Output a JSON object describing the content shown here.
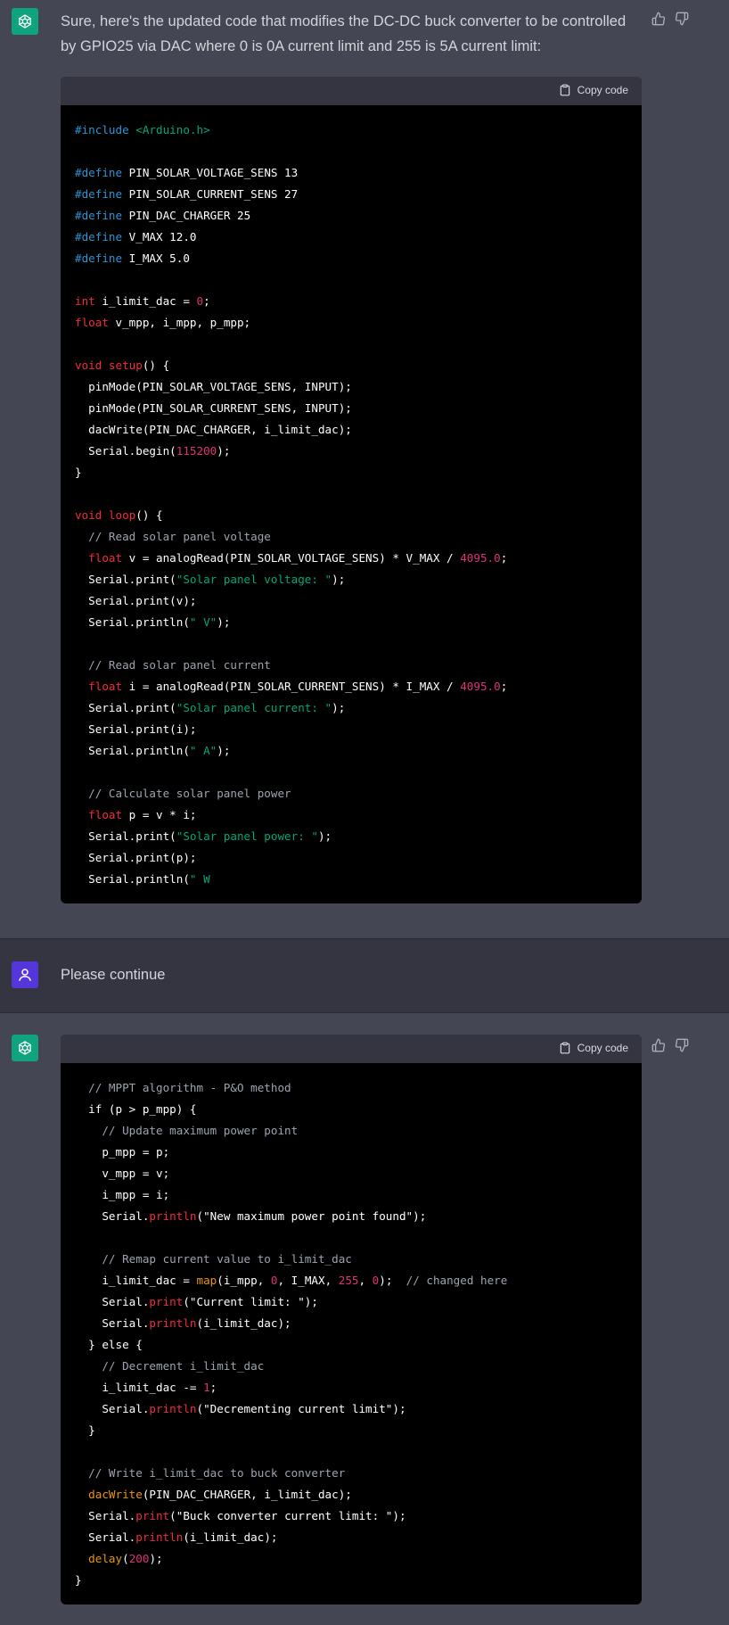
{
  "messages": {
    "first": {
      "text": "Sure, here's the updated code that modifies the DC-DC buck converter to be controlled by GPIO25 via DAC where 0 is 0A current limit and 255 is 5A current limit:",
      "copy_label": "Copy code",
      "code": [
        [
          [
            "#",
            "kw"
          ],
          [
            "include ",
            "kw"
          ],
          [
            "<Arduino.h>",
            "inc"
          ]
        ],
        [],
        [
          [
            "#define ",
            "kw"
          ],
          [
            "PIN_SOLAR_VOLTAGE_SENS 13",
            ""
          ]
        ],
        [
          [
            "#define ",
            "kw"
          ],
          [
            "PIN_SOLAR_CURRENT_SENS 27",
            ""
          ]
        ],
        [
          [
            "#define ",
            "kw"
          ],
          [
            "PIN_DAC_CHARGER 25",
            ""
          ]
        ],
        [
          [
            "#define ",
            "kw"
          ],
          [
            "V_MAX 12.0",
            ""
          ]
        ],
        [
          [
            "#define ",
            "kw"
          ],
          [
            "I_MAX 5.0",
            ""
          ]
        ],
        [],
        [
          [
            "int ",
            "ty"
          ],
          [
            "i_limit_dac = ",
            ""
          ],
          [
            "0",
            "num"
          ],
          [
            ";",
            ""
          ]
        ],
        [
          [
            "float ",
            "ty"
          ],
          [
            "v_mpp, i_mpp, p_mpp;",
            ""
          ]
        ],
        [],
        [
          [
            "void ",
            "ty"
          ],
          [
            "setup",
            "ty"
          ],
          [
            "() {",
            ""
          ]
        ],
        [
          [
            "  pinMode(PIN_SOLAR_VOLTAGE_SENS, INPUT);",
            ""
          ]
        ],
        [
          [
            "  pinMode(PIN_SOLAR_CURRENT_SENS, INPUT);",
            ""
          ]
        ],
        [
          [
            "  dacWrite(PIN_DAC_CHARGER, i_limit_dac);",
            ""
          ]
        ],
        [
          [
            "  Serial.begin(",
            ""
          ],
          [
            "115200",
            "num"
          ],
          [
            ");",
            ""
          ]
        ],
        [
          [
            "}",
            ""
          ]
        ],
        [],
        [
          [
            "void ",
            "ty"
          ],
          [
            "loop",
            "ty"
          ],
          [
            "() {",
            ""
          ]
        ],
        [
          [
            "  // Read solar panel voltage",
            "cm"
          ]
        ],
        [
          [
            "  ",
            ""
          ],
          [
            "float ",
            "ty"
          ],
          [
            "v = analogRead(PIN_SOLAR_VOLTAGE_SENS) * V_MAX / ",
            ""
          ],
          [
            "4095.0",
            "num"
          ],
          [
            ";",
            ""
          ]
        ],
        [
          [
            "  Serial.print(",
            ""
          ],
          [
            "\"Solar panel voltage: \"",
            "str"
          ],
          [
            ");",
            ""
          ]
        ],
        [
          [
            "  Serial.print(v);",
            ""
          ]
        ],
        [
          [
            "  Serial.println(",
            ""
          ],
          [
            "\" V\"",
            "str"
          ],
          [
            ");",
            ""
          ]
        ],
        [],
        [
          [
            "  // Read solar panel current",
            "cm"
          ]
        ],
        [
          [
            "  ",
            ""
          ],
          [
            "float ",
            "ty"
          ],
          [
            "i = analogRead(PIN_SOLAR_CURRENT_SENS) * I_MAX / ",
            ""
          ],
          [
            "4095.0",
            "num"
          ],
          [
            ";",
            ""
          ]
        ],
        [
          [
            "  Serial.print(",
            ""
          ],
          [
            "\"Solar panel current: \"",
            "str"
          ],
          [
            ");",
            ""
          ]
        ],
        [
          [
            "  Serial.print(i);",
            ""
          ]
        ],
        [
          [
            "  Serial.println(",
            ""
          ],
          [
            "\" A\"",
            "str"
          ],
          [
            ");",
            ""
          ]
        ],
        [],
        [
          [
            "  // Calculate solar panel power",
            "cm"
          ]
        ],
        [
          [
            "  ",
            ""
          ],
          [
            "float ",
            "ty"
          ],
          [
            "p = v * i;",
            ""
          ]
        ],
        [
          [
            "  Serial.print(",
            ""
          ],
          [
            "\"Solar panel power: \"",
            "str"
          ],
          [
            ");",
            ""
          ]
        ],
        [
          [
            "  Serial.print(p);",
            ""
          ]
        ],
        [
          [
            "  Serial.println(",
            ""
          ],
          [
            "\" W",
            "str"
          ]
        ]
      ]
    },
    "user": {
      "text": "Please continue"
    },
    "second": {
      "copy_label": "Copy code",
      "code": [
        [
          [
            "  // MPPT algorithm - P&O method",
            "cm"
          ]
        ],
        [
          [
            "  if (p > p_mpp) {",
            ""
          ]
        ],
        [
          [
            "    // Update maximum power point",
            "cm"
          ]
        ],
        [
          [
            "    p_mpp = p;",
            ""
          ]
        ],
        [
          [
            "    v_mpp = v;",
            ""
          ]
        ],
        [
          [
            "    i_mpp = i;",
            ""
          ]
        ],
        [
          [
            "    Serial.",
            ""
          ],
          [
            "println",
            "ty"
          ],
          [
            "(\"New maximum power point found\");",
            ""
          ]
        ],
        [],
        [
          [
            "    // Remap current value to i_limit_dac",
            "cm"
          ]
        ],
        [
          [
            "    i_limit_dac = ",
            ""
          ],
          [
            "map",
            "fn"
          ],
          [
            "(i_mpp, ",
            ""
          ],
          [
            "0",
            "num"
          ],
          [
            ", I_MAX, ",
            ""
          ],
          [
            "255",
            "num"
          ],
          [
            ", ",
            ""
          ],
          [
            "0",
            "num"
          ],
          [
            ");  ",
            ""
          ],
          [
            "// changed here",
            "cm"
          ]
        ],
        [
          [
            "    Serial.",
            ""
          ],
          [
            "print",
            "ty"
          ],
          [
            "(\"Current limit: \");",
            ""
          ]
        ],
        [
          [
            "    Serial.",
            ""
          ],
          [
            "println",
            "ty"
          ],
          [
            "(i_limit_dac);",
            ""
          ]
        ],
        [
          [
            "  } else {",
            ""
          ]
        ],
        [
          [
            "    // Decrement i_limit_dac",
            "cm"
          ]
        ],
        [
          [
            "    i_limit_dac -= ",
            ""
          ],
          [
            "1",
            "num"
          ],
          [
            ";",
            ""
          ]
        ],
        [
          [
            "    Serial.",
            ""
          ],
          [
            "println",
            "ty"
          ],
          [
            "(\"Decrementing current limit\");",
            ""
          ]
        ],
        [
          [
            "  }",
            ""
          ]
        ],
        [],
        [
          [
            "  // Write i_limit_dac to buck converter",
            "cm"
          ]
        ],
        [
          [
            "  ",
            ""
          ],
          [
            "dacWrite",
            "fn"
          ],
          [
            "(PIN_DAC_CHARGER, i_limit_dac);",
            ""
          ]
        ],
        [
          [
            "  Serial.",
            ""
          ],
          [
            "print",
            "ty"
          ],
          [
            "(\"Buck converter current limit: \");",
            ""
          ]
        ],
        [
          [
            "  Serial.",
            ""
          ],
          [
            "println",
            "ty"
          ],
          [
            "(i_limit_dac);",
            ""
          ]
        ],
        [
          [
            "  ",
            ""
          ],
          [
            "delay",
            "fn"
          ],
          [
            "(",
            ""
          ],
          [
            "200",
            "num"
          ],
          [
            ");",
            ""
          ]
        ],
        [
          [
            "}",
            ""
          ]
        ]
      ]
    }
  },
  "colors": {
    "assistant_bg": "#444654",
    "user_bg": "#343541",
    "gpt_avatar": "#10a37f",
    "user_avatar": "#5436da"
  },
  "icons": [
    "openai-logo-icon",
    "thumbs-up-icon",
    "thumbs-down-icon",
    "clipboard-icon",
    "user-icon"
  ]
}
